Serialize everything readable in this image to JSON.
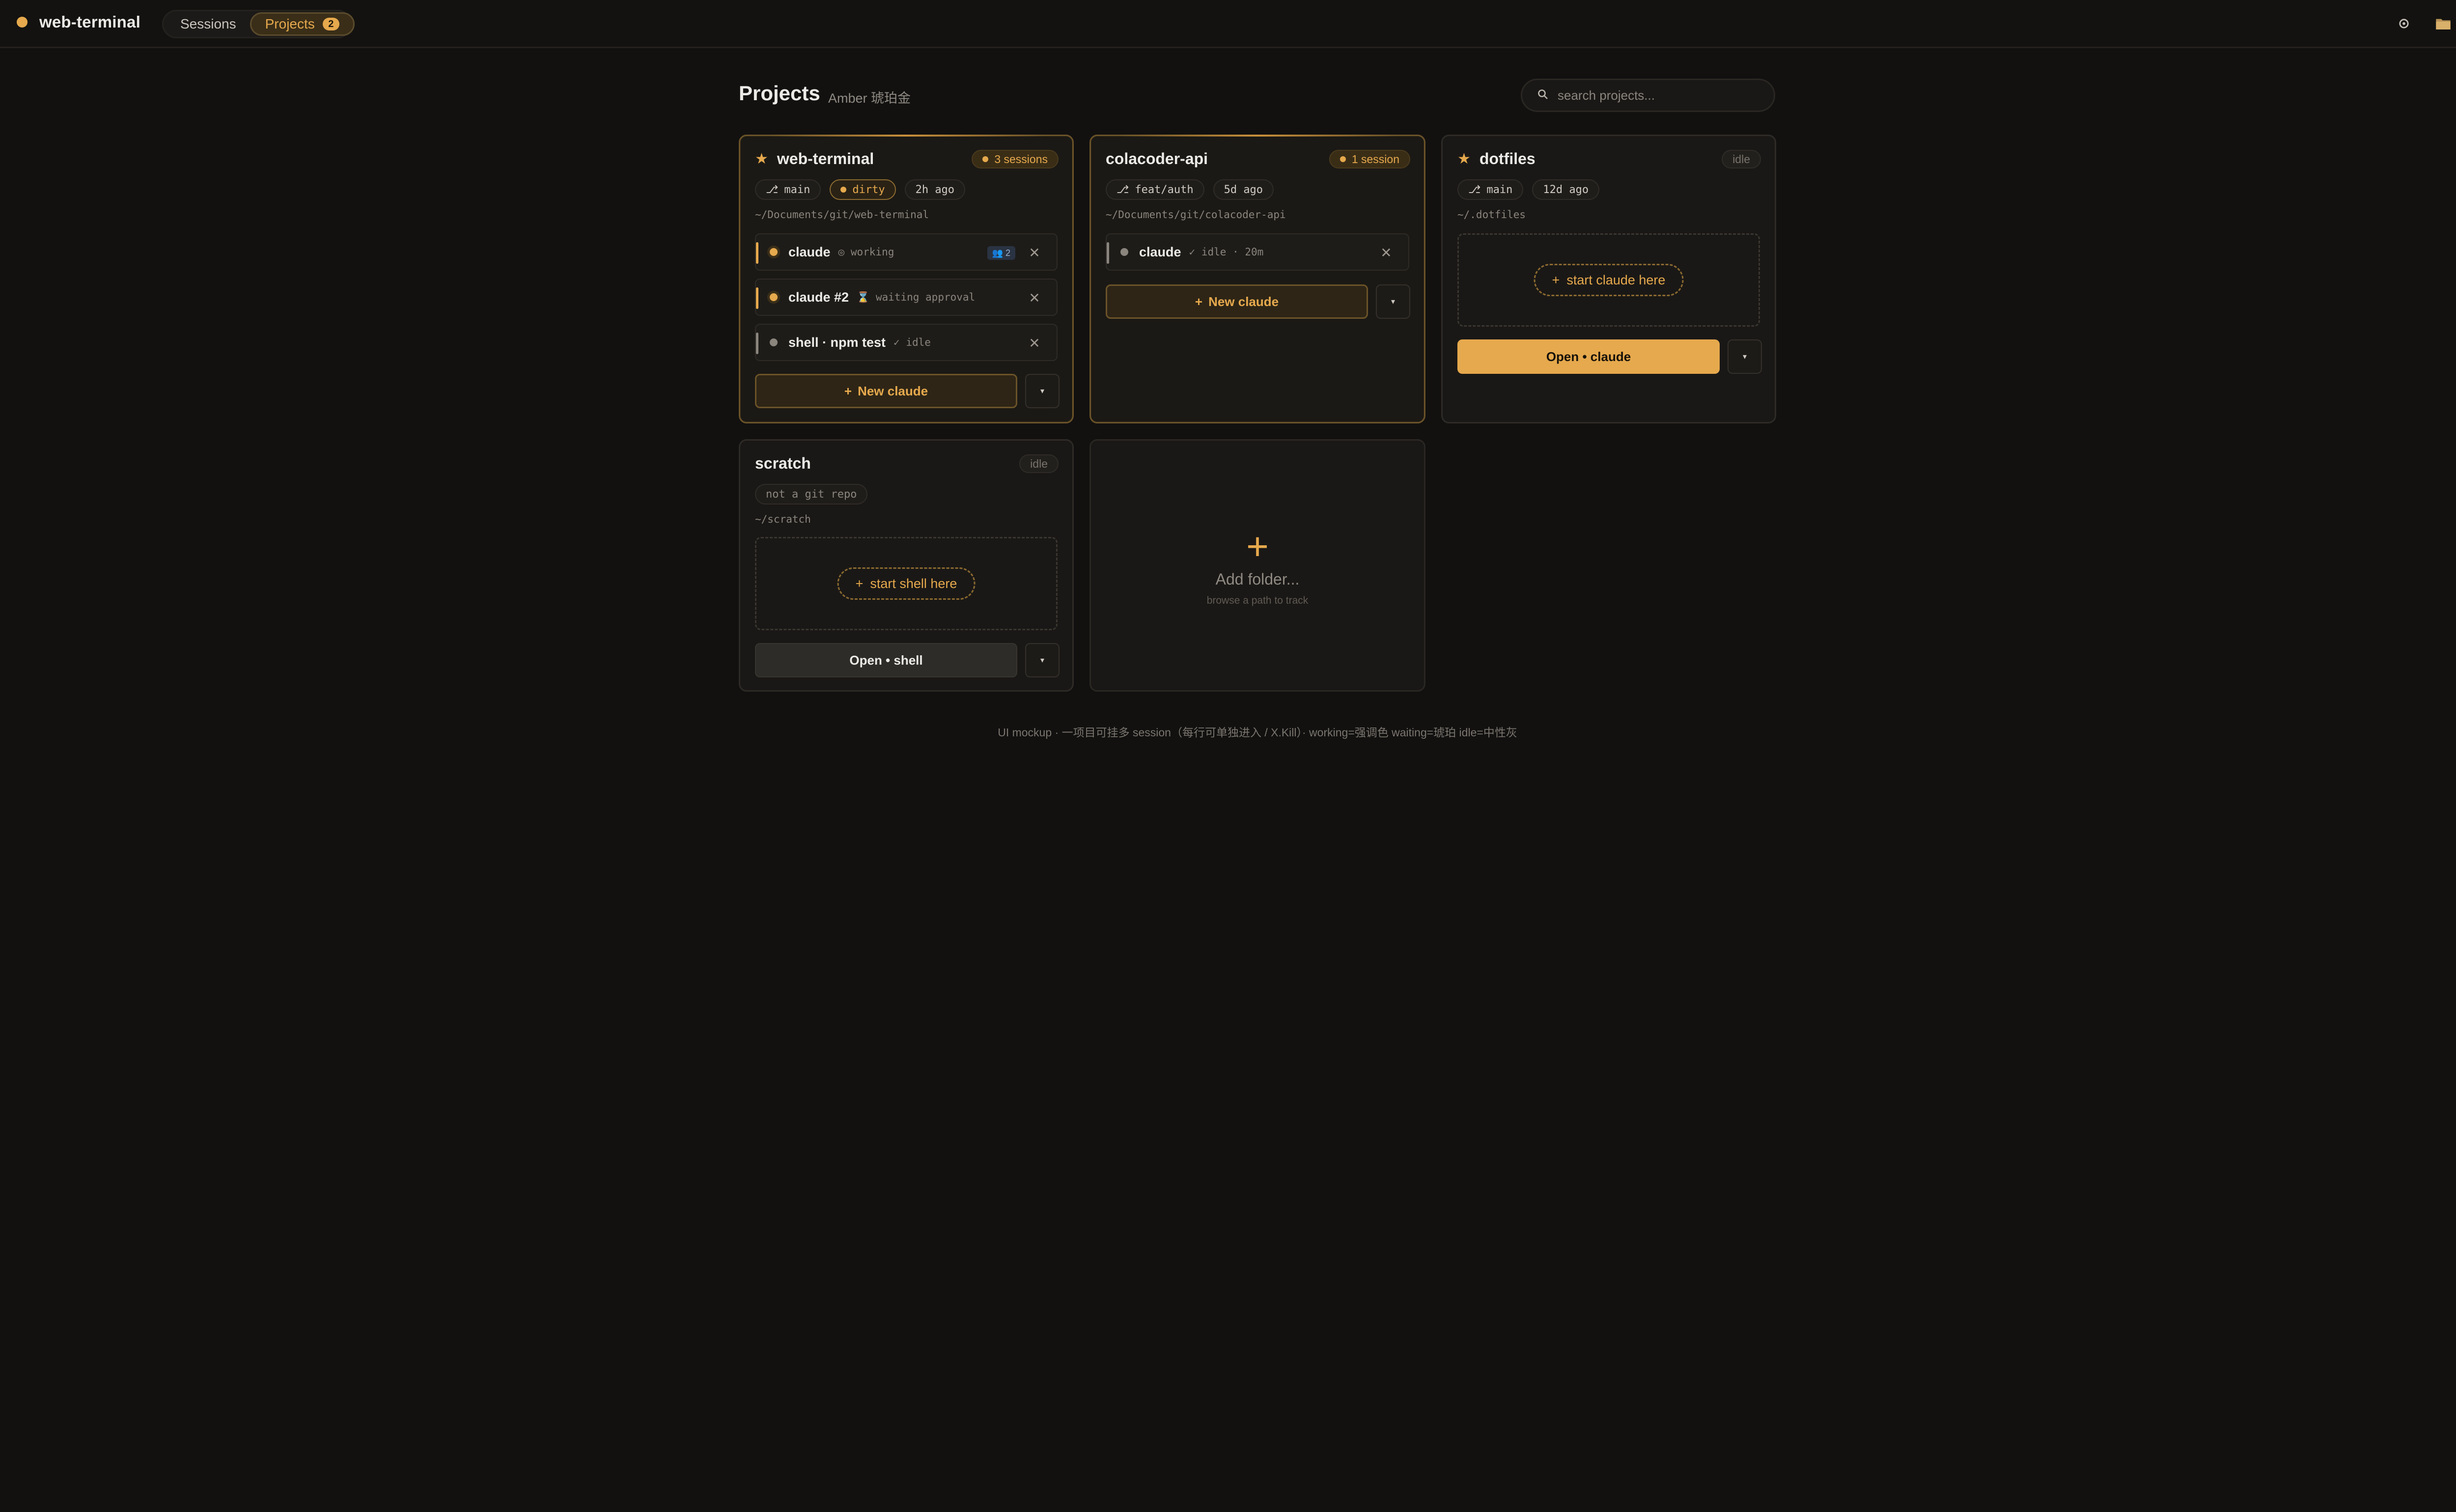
{
  "app": {
    "title": "web-terminal"
  },
  "nav": {
    "sessions_label": "Sessions",
    "projects_label": "Projects",
    "projects_count": "2"
  },
  "toolbar": {
    "icons": [
      "settings-icon",
      "folder-icon",
      "keyboard-icon"
    ]
  },
  "header": {
    "title": "Projects",
    "subtitle": "Amber 琥珀金",
    "search_placeholder": "search projects..."
  },
  "projects": [
    {
      "name": "web-terminal",
      "starred": true,
      "status": "3 sessions",
      "branch": "main",
      "dirty": "dirty",
      "updated": "2h ago",
      "path": "~/Documents/git/web-terminal",
      "sessions": [
        {
          "name": "claude",
          "state_icon": "◎",
          "state": "working",
          "badge": "👥 2"
        },
        {
          "name": "claude #2",
          "state_icon": "⌛",
          "state": "waiting approval"
        },
        {
          "name": "shell · npm test",
          "state_icon": "✓",
          "state": "idle"
        }
      ],
      "action": "New claude"
    },
    {
      "name": "colacoder-api",
      "starred": false,
      "status": "1 session",
      "branch": "feat/auth",
      "updated": "5d ago",
      "path": "~/Documents/git/colacoder-api",
      "sessions": [
        {
          "name": "claude",
          "state_icon": "✓",
          "state": "idle · 20m"
        }
      ],
      "action": "New claude"
    },
    {
      "name": "dotfiles",
      "starred": true,
      "status": "idle",
      "branch": "main",
      "updated": "12d ago",
      "path": "~/.dotfiles",
      "empty_cta": "start claude here",
      "action": "Open • claude"
    },
    {
      "name": "scratch",
      "starred": false,
      "status": "idle",
      "tag": "not a git repo",
      "path": "~/scratch",
      "empty_cta": "start shell here",
      "action": "Open • shell"
    }
  ],
  "add_folder": {
    "title": "Add folder...",
    "subtitle": "browse a path to track"
  },
  "footnote": "UI mockup · 一项目可挂多 session（每行可单独进入 / X.Kill）· working=强调色 waiting=琥珀 idle=中性灰",
  "colors": {
    "accent": "#e6a94d",
    "background": "#121110",
    "idle": "#8a857d"
  }
}
